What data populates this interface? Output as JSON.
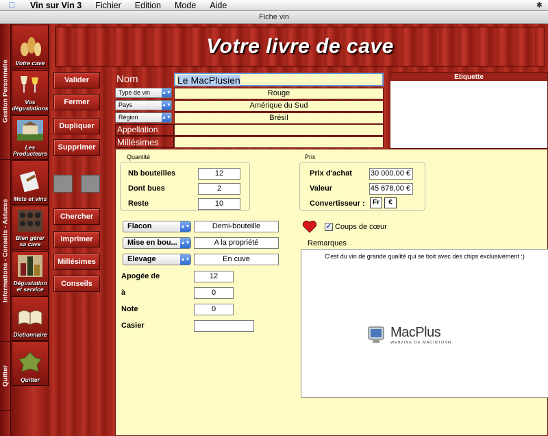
{
  "menubar": {
    "app": "Vin sur Vin 3",
    "items": [
      "Fichier",
      "Edition",
      "Mode",
      "Aide"
    ]
  },
  "window": {
    "title": "Fiche vin"
  },
  "left_tabs": [
    "Gestion Personnelle",
    "Informations - Conseils - Astuces",
    "Quitter"
  ],
  "sidebar": [
    {
      "label": "Votre cave"
    },
    {
      "label": "Vos dégustations"
    },
    {
      "label": "Les Producteurs"
    },
    {
      "label": "Mets et vins"
    },
    {
      "label": "Bien gérer sa cave"
    },
    {
      "label": "Dégustation et service"
    },
    {
      "label": "Dictionnaire"
    },
    {
      "label": "Quitter"
    }
  ],
  "header": {
    "title": "Votre livre de cave"
  },
  "actions": {
    "top": [
      "Valider",
      "Fermer",
      "Dupliquer",
      "Supprimer"
    ],
    "bottom": [
      "Chercher",
      "Imprimer",
      "Millésimes",
      "Conseils"
    ]
  },
  "form": {
    "nom_label": "Nom",
    "nom_value": "Le MacPlusien",
    "type_vin": {
      "label": "Type de vin",
      "value": "Rouge"
    },
    "pays": {
      "label": "Pays",
      "value": "Amérique du Sud"
    },
    "region": {
      "label": "Région",
      "value": "Brésil"
    },
    "appellation_label": "Appellation",
    "appellation_value": "",
    "millesimes_label": "Millésimes",
    "millesimes_value": ""
  },
  "etiquette": {
    "title": "Etiquette"
  },
  "quantite": {
    "title": "Quantité",
    "nb_label": "Nb bouteilles",
    "nb_value": "12",
    "bues_label": "Dont bues",
    "bues_value": "2",
    "reste_label": "Reste",
    "reste_value": "10"
  },
  "prix": {
    "title": "Prix",
    "achat_label": "Prix d'achat",
    "achat_value": "30 000,00 €",
    "valeur_label": "Valeur",
    "valeur_value": "45 678,00 €",
    "conv_label": "Convertisseur :",
    "fr": "Fr",
    "eur": "€"
  },
  "details": {
    "flacon": {
      "label": "Flacon",
      "value": "Demi-bouteille"
    },
    "mise": {
      "label": "Mise en bou...",
      "value": "A la propriété"
    },
    "elevage": {
      "label": "Elevage",
      "value": "En cuve"
    },
    "apogee_label": "Apogée de",
    "apogee_value": "12",
    "a_label": "à",
    "a_value": "0",
    "note_label": "Note",
    "note_value": "0",
    "casier_label": "Casier",
    "casier_value": ""
  },
  "coeur": {
    "label": "Coups de cœur",
    "checked": true
  },
  "remarques": {
    "title": "Remarques",
    "text": "C'est du vin de grande qualité qui se boit avec des chips exclusivement :)"
  },
  "logo": {
    "name": "MacPlus",
    "tagline": "WEBZINE DU MACINTOSH"
  },
  "colors": {
    "bg_red": "#9b2218",
    "panel_yellow": "#fefcc4",
    "accent_blue": "#2e6cd0"
  }
}
